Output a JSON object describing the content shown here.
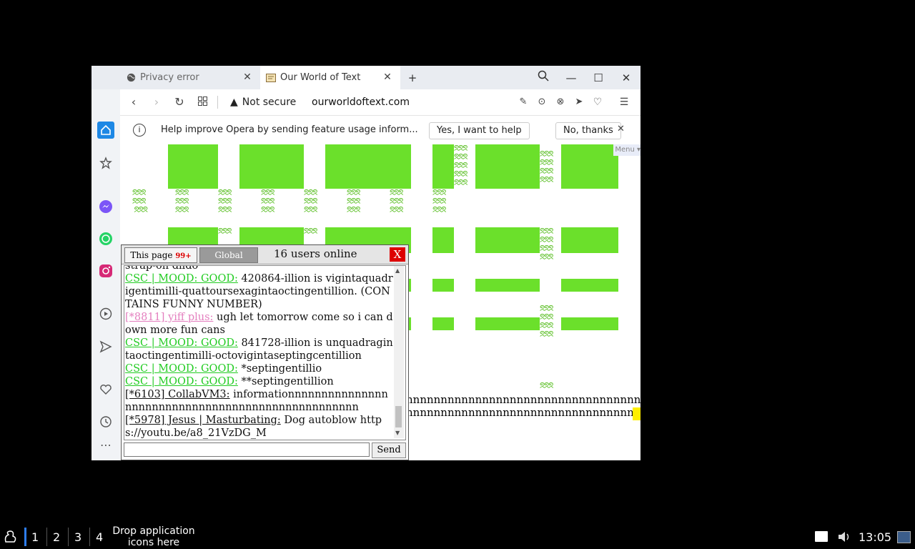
{
  "browser": {
    "tabs": [
      {
        "title": "Privacy error",
        "icon": "globe-icon"
      },
      {
        "title": "Our World of Text",
        "icon": "map-icon"
      }
    ],
    "address": {
      "security": "Not secure",
      "url": "ourworldoftext.com"
    },
    "infobar": {
      "message": "Help improve Opera by sending feature usage inform...",
      "accept": "Yes, I want to help",
      "decline": "No, thanks"
    },
    "menu_label": "Menu ▾"
  },
  "page": {
    "n_row_1": "nnnnnnnnnnnnnnnnnnnnnnnnnnnnnnnnnnnnnn",
    "n_row_2": "nnnnnnnnnnnnnnnnnnnnnnnnnnnnnnnnnnnnnn"
  },
  "chat": {
    "tab_page": "This page",
    "tab_page_badge": "99+",
    "tab_global": "Global",
    "users_online": "16 users online",
    "close": "X",
    "send": "Send",
    "partial_top": "strap-on dildo",
    "messages": [
      {
        "nick": "CSC | MOOD: GOOD:",
        "text": " 420864-illion is vigintaquadrigentimilli-quattoursexagintaoctingentillion. (CONTAINS FUNNY NUMBER)",
        "color": "#22cc22"
      },
      {
        "nick": "[*8811] yiff plus:",
        "text": " ugh let tomorrow come so i can down more fun cans",
        "color": "#e47fbf"
      },
      {
        "nick": "CSC | MOOD: GOOD:",
        "text": " 841728-illion is unquadragintaoctingentimilli-octovigintaseptingcentillion",
        "color": "#22cc22"
      },
      {
        "nick": "CSC | MOOD: GOOD:",
        "text": " *septingentillio",
        "color": "#22cc22"
      },
      {
        "nick": "CSC | MOOD: GOOD:",
        "text": " **septingentillion",
        "color": "#22cc22"
      },
      {
        "nick": "[*6103] CollabVM3:",
        "text": " informationnnnnnnnnnnnnnnnnnnnnnnnnnnnnnnnnnnnnnnnnnnnnnnnnn",
        "color": "#111111"
      },
      {
        "nick": "[*5978] Jesus | Masturbating:",
        "text": " Dog autoblow https://youtu.be/a8_21VzDG_M",
        "color": "#111111"
      }
    ]
  },
  "taskbar": {
    "workspaces": [
      "1",
      "2",
      "3",
      "4"
    ],
    "drop_text_1": "Drop application",
    "drop_text_2": "icons here",
    "clock": "13:05"
  }
}
